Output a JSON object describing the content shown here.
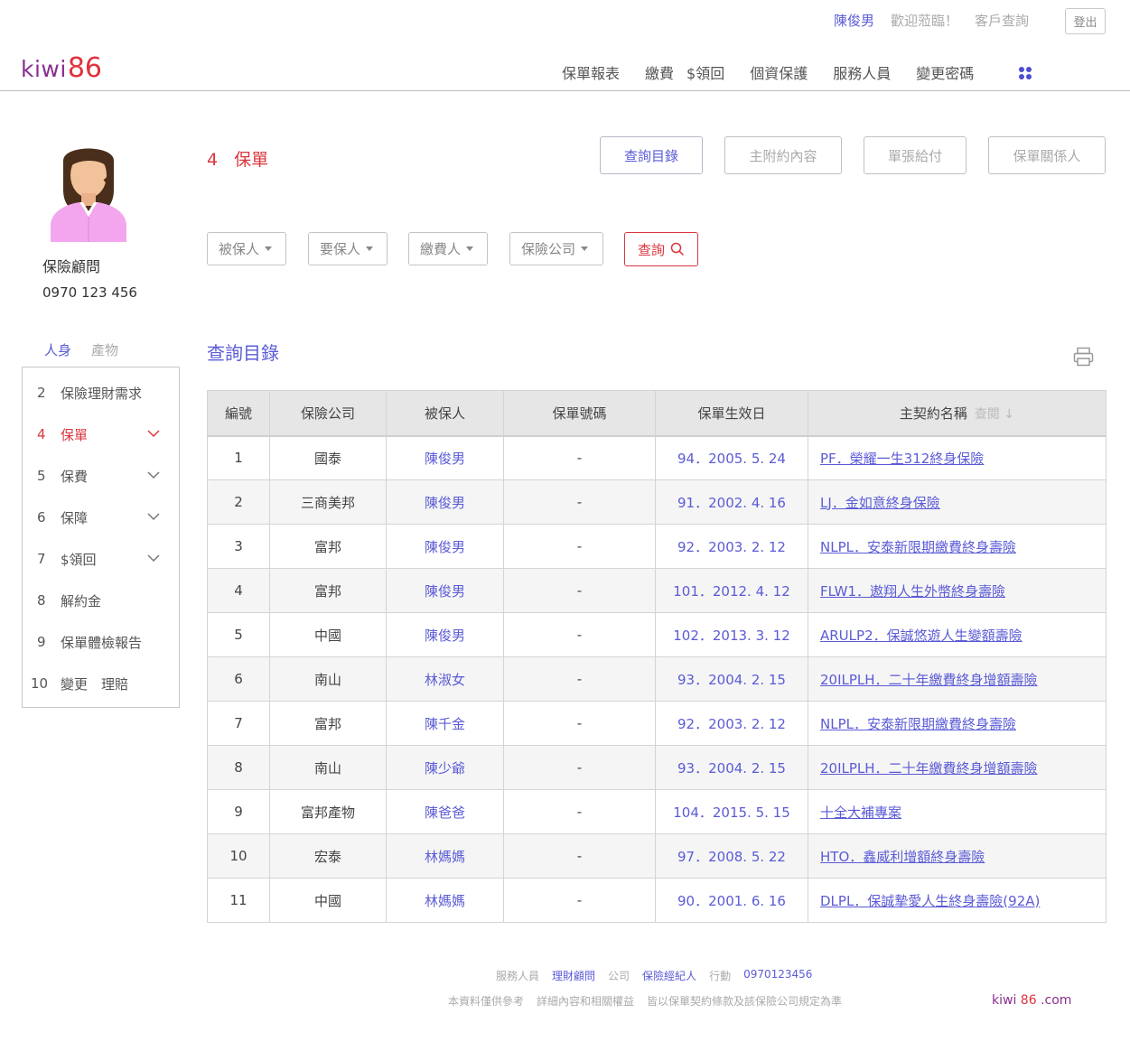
{
  "header": {
    "user_name": "陳俊男",
    "welcome": "歡迎蒞臨！",
    "client_query": "客戶查詢",
    "logout": "登出",
    "logo_text": "kiwi",
    "logo_number": "86",
    "nav": [
      "保單報表",
      "繳費",
      "$領回",
      "個資保護",
      "服務人員",
      "變更密碼"
    ],
    "apps_icon": "grid-dots-icon"
  },
  "profile": {
    "title": "保險顧問",
    "phone": "0970 123 456",
    "tabs": [
      "人身",
      "產物"
    ]
  },
  "sidemenu": [
    {
      "num": "2",
      "label": "保險理財需求",
      "chevron": false,
      "active": false
    },
    {
      "num": "4",
      "label": "保單",
      "chevron": true,
      "active": true
    },
    {
      "num": "5",
      "label": "保費",
      "chevron": true,
      "active": false
    },
    {
      "num": "6",
      "label": "保障",
      "chevron": true,
      "active": false
    },
    {
      "num": "7",
      "label": "$領回",
      "chevron": true,
      "active": false
    },
    {
      "num": "8",
      "label": "解約金",
      "chevron": false,
      "active": false
    },
    {
      "num": "9",
      "label": "保單體檢報告",
      "chevron": false,
      "active": false
    },
    {
      "num": "10",
      "label": "變更　理賠",
      "chevron": false,
      "active": false
    }
  ],
  "page": {
    "heading_num": "4",
    "heading_label": "保單",
    "tab_buttons": [
      "查詢目錄",
      "主附約內容",
      "單張給付",
      "保單關係人"
    ],
    "filters": [
      "被保人",
      "要保人",
      "繳費人",
      "保險公司"
    ],
    "search_label": "查詢",
    "section_title": "查詢目錄"
  },
  "table": {
    "headers": [
      "編號",
      "保險公司",
      "被保人",
      "保單號碼",
      "保單生效日",
      "主契約名稱"
    ],
    "sort_label": "查閱",
    "rows": [
      {
        "no": "1",
        "company": "國泰",
        "insured": "陳俊男",
        "policy_no": "-",
        "date": "94．2005. 5. 24",
        "plan": "PF．榮耀一生312終身保險"
      },
      {
        "no": "2",
        "company": "三商美邦",
        "insured": "陳俊男",
        "policy_no": "-",
        "date": "91．2002. 4. 16",
        "plan": "LJ．金如意終身保險"
      },
      {
        "no": "3",
        "company": "富邦",
        "insured": "陳俊男",
        "policy_no": "-",
        "date": "92．2003. 2. 12",
        "plan": "NLPL．安泰新限期繳費終身壽險"
      },
      {
        "no": "4",
        "company": "富邦",
        "insured": "陳俊男",
        "policy_no": "-",
        "date": "101．2012. 4. 12",
        "plan": "FLW1．遨翔人生外幣終身壽險"
      },
      {
        "no": "5",
        "company": "中國",
        "insured": "陳俊男",
        "policy_no": "-",
        "date": "102．2013. 3. 12",
        "plan": "ARULP2．保誠悠遊人生變額壽險"
      },
      {
        "no": "6",
        "company": "南山",
        "insured": "林淑女",
        "policy_no": "-",
        "date": "93．2004. 2. 15",
        "plan": "20ILPLH．二十年繳費終身增額壽險"
      },
      {
        "no": "7",
        "company": "富邦",
        "insured": "陳千金",
        "policy_no": "-",
        "date": "92．2003. 2. 12",
        "plan": "NLPL．安泰新限期繳費終身壽險"
      },
      {
        "no": "8",
        "company": "南山",
        "insured": "陳少爺",
        "policy_no": "-",
        "date": "93．2004. 2. 15",
        "plan": "20ILPLH．二十年繳費終身增額壽險"
      },
      {
        "no": "9",
        "company": "富邦產物",
        "insured": "陳爸爸",
        "policy_no": "-",
        "date": "104．2015. 5. 15",
        "plan": "十全大補專案"
      },
      {
        "no": "10",
        "company": "宏泰",
        "insured": "林媽媽",
        "policy_no": "-",
        "date": "97．2008. 5. 22",
        "plan": "HTO．鑫威利增額終身壽險"
      },
      {
        "no": "11",
        "company": "中國",
        "insured": "林媽媽",
        "policy_no": "-",
        "date": "90．2001. 6. 16",
        "plan": "DLPL．保誠摯愛人生終身壽險(92A)"
      }
    ]
  },
  "footer": {
    "line1": [
      "服務人員",
      "理財顧問",
      "公司",
      "保險經紀人",
      "行動",
      "0970123456"
    ],
    "line2": [
      "本資料僅供參考",
      "詳細內容和相關權益",
      "皆以保單契約條款及該保險公司規定為準"
    ],
    "logo_prefix": "kiwi ",
    "logo_number": "86",
    "logo_suffix": " .com"
  },
  "colors": {
    "accent_blue": "#5b5bd6",
    "accent_red": "#d9363e",
    "logo_purple": "#8b2f8f"
  }
}
